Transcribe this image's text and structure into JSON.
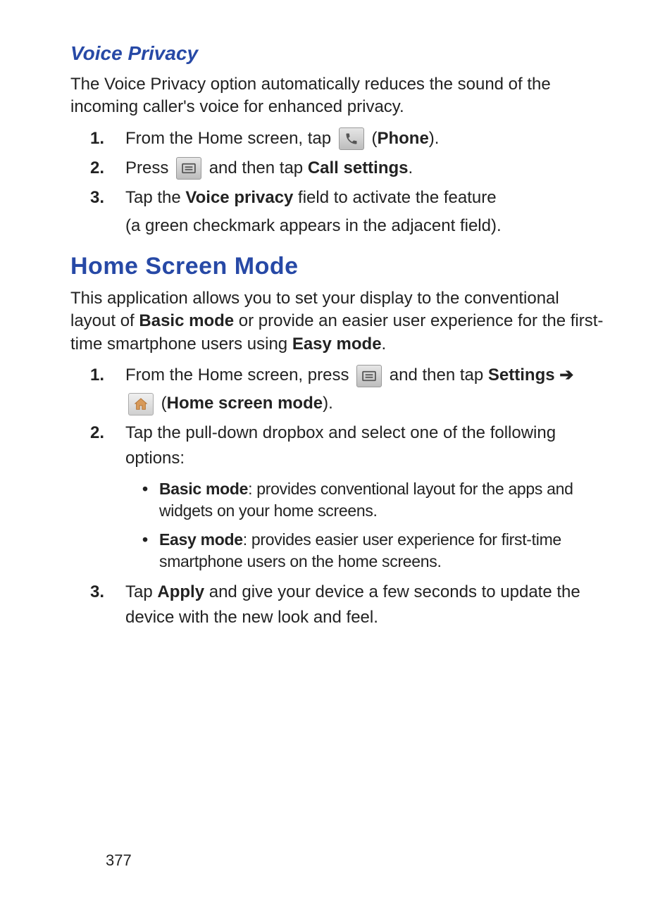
{
  "section1": {
    "title": "Voice Privacy",
    "intro": "The Voice Privacy option automatically reduces the sound of the incoming caller's voice for enhanced privacy.",
    "steps": {
      "s1_a": "From the Home screen, tap ",
      "s1_b": " (",
      "s1_c": "Phone",
      "s1_d": ").",
      "s2_a": "Press ",
      "s2_b": " and then tap ",
      "s2_c": "Call settings",
      "s2_d": ".",
      "s3_a": "Tap the ",
      "s3_b": "Voice privacy",
      "s3_c": " field to activate the feature",
      "s3_sub": "(a green checkmark appears in the adjacent field)."
    }
  },
  "section2": {
    "title": "Home Screen Mode",
    "intro_a": "This application allows you to set your display to the conventional layout of ",
    "intro_b": "Basic mode",
    "intro_c": " or provide an easier user experience for the first-time smartphone users using ",
    "intro_d": "Easy mode",
    "intro_e": ".",
    "steps": {
      "s1_a": "From the Home screen, press ",
      "s1_b": " and then tap ",
      "s1_c": "Settings",
      "s1_arrow": " ➔ ",
      "s1_d": " (",
      "s1_e": "Home screen mode",
      "s1_f": ").",
      "s2": "Tap the pull-down dropbox and select one of the following options:",
      "b1_a": "Basic mode",
      "b1_b": ": provides conventional layout for the apps and widgets on your home screens.",
      "b2_a": "Easy mode",
      "b2_b": ": provides easier user experience for first-time smartphone users on the home screens.",
      "s3_a": "Tap ",
      "s3_b": "Apply",
      "s3_c": " and give your device a few seconds to update the device with the new look and feel."
    }
  },
  "page_number": "377",
  "nums": {
    "n1": "1.",
    "n2": "2.",
    "n3": "3."
  }
}
